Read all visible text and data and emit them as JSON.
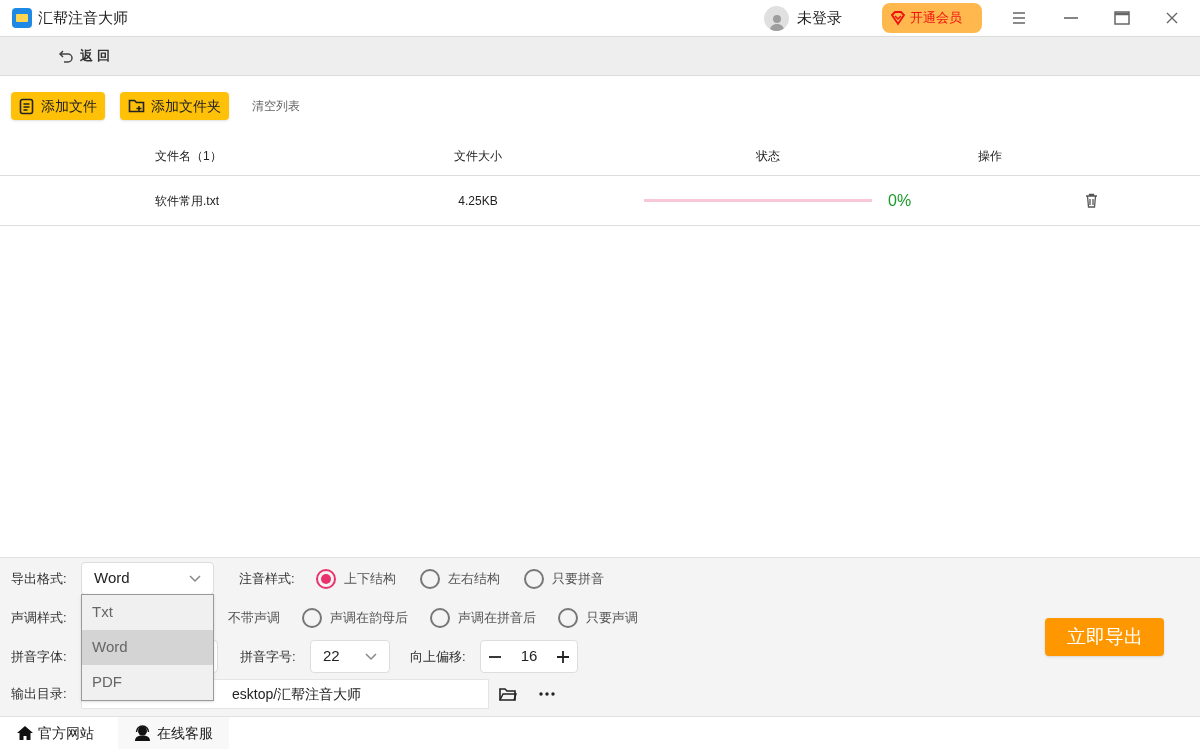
{
  "window": {
    "title": "汇帮注音大师",
    "user": "未登录",
    "vip_button": "开通会员"
  },
  "back_button": "返 回",
  "toolbar": {
    "add_file": "添加文件",
    "add_folder": "添加文件夹",
    "clear": "清空列表"
  },
  "table": {
    "columns": [
      "文件名（1）",
      "文件大小",
      "状态",
      "操作"
    ],
    "rows": [
      {
        "name": "软件常用.txt",
        "size": "4.25KB",
        "progress": "0%"
      }
    ]
  },
  "settings": {
    "format": {
      "label": "导出格式:",
      "value": "Word",
      "expanded": true,
      "options": [
        {
          "label": "Txt",
          "selected": false
        },
        {
          "label": "Word",
          "selected": true
        },
        {
          "label": "PDF",
          "selected": false
        }
      ]
    },
    "annotation": {
      "label": "注音样式:",
      "options": [
        {
          "label": "上下结构",
          "selected": true
        },
        {
          "label": "左右结构",
          "selected": false
        },
        {
          "label": "只要拼音",
          "selected": false
        }
      ]
    },
    "tone": {
      "label": "声调样式:",
      "options": [
        {
          "label": "不带声调"
        },
        {
          "label": "声调在韵母后",
          "selected": false
        },
        {
          "label": "声调在拼音后",
          "selected": false
        },
        {
          "label": "只要声调",
          "selected": false
        }
      ]
    },
    "font": {
      "label": "拼音字体:"
    },
    "size": {
      "label": "拼音字号:",
      "value": "22"
    },
    "offset": {
      "label": "向上偏移:",
      "value": "16"
    },
    "output": {
      "label": "输出目录:",
      "value": "esktop/汇帮注音大师"
    },
    "export_button": "立即导出"
  },
  "footer": {
    "website": "官方网站",
    "support": "在线客服"
  }
}
